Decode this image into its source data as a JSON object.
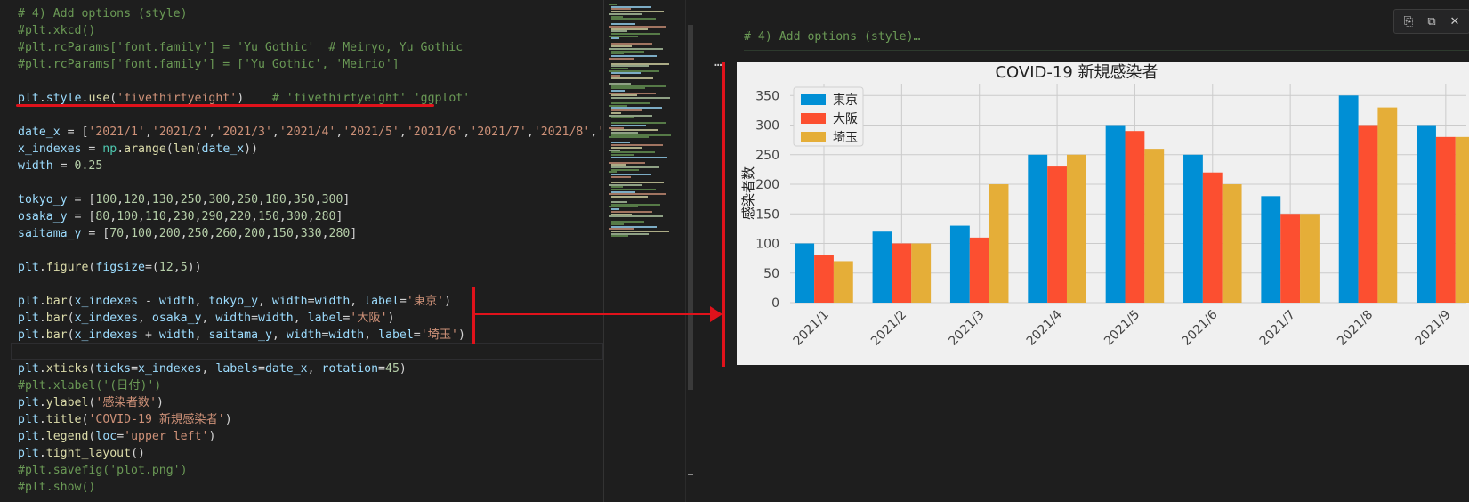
{
  "editor": {
    "lines": [
      {
        "top": 6,
        "spans": [
          [
            "c-cmt",
            "# 4) Add options (style)"
          ]
        ]
      },
      {
        "top": 25,
        "spans": [
          [
            "c-cmt",
            "#plt.xkcd()"
          ]
        ]
      },
      {
        "top": 44,
        "spans": [
          [
            "c-cmt",
            "#plt.rcParams['font.family'] = 'Yu Gothic'  # Meiryo, Yu Gothic"
          ]
        ]
      },
      {
        "top": 63,
        "spans": [
          [
            "c-cmt",
            "#plt.rcParams['font.family'] = ['Yu Gothic', 'Meirio']"
          ]
        ]
      },
      {
        "top": 101,
        "spans": [
          [
            "c-var",
            "plt"
          ],
          [
            "c-op",
            "."
          ],
          [
            "c-var",
            "style"
          ],
          [
            "c-op",
            "."
          ],
          [
            "c-fn",
            "use"
          ],
          [
            "c-op",
            "("
          ],
          [
            "c-str",
            "'fivethirtyeight'"
          ],
          [
            "c-op",
            ")    "
          ],
          [
            "c-cmt",
            "# 'fivethirtyeight' 'ggplot'"
          ]
        ]
      },
      {
        "top": 139,
        "spans": [
          [
            "c-var",
            "date_x"
          ],
          [
            "c-op",
            " = ["
          ],
          [
            "c-str",
            "'2021/1'"
          ],
          [
            "c-op",
            ","
          ],
          [
            "c-str",
            "'2021/2'"
          ],
          [
            "c-op",
            ","
          ],
          [
            "c-str",
            "'2021/3'"
          ],
          [
            "c-op",
            ","
          ],
          [
            "c-str",
            "'2021/4'"
          ],
          [
            "c-op",
            ","
          ],
          [
            "c-str",
            "'2021/5'"
          ],
          [
            "c-op",
            ","
          ],
          [
            "c-str",
            "'2021/6'"
          ],
          [
            "c-op",
            ","
          ],
          [
            "c-str",
            "'2021/7'"
          ],
          [
            "c-op",
            ","
          ],
          [
            "c-str",
            "'2021/8'"
          ],
          [
            "c-op",
            ","
          ],
          [
            "c-str",
            "'202"
          ]
        ]
      },
      {
        "top": 158,
        "spans": [
          [
            "c-var",
            "x_indexes"
          ],
          [
            "c-op",
            " = "
          ],
          [
            "c-cls",
            "np"
          ],
          [
            "c-op",
            "."
          ],
          [
            "c-fn",
            "arange"
          ],
          [
            "c-op",
            "("
          ],
          [
            "c-fn",
            "len"
          ],
          [
            "c-op",
            "("
          ],
          [
            "c-var",
            "date_x"
          ],
          [
            "c-op",
            "))"
          ]
        ]
      },
      {
        "top": 177,
        "spans": [
          [
            "c-var",
            "width"
          ],
          [
            "c-op",
            " = "
          ],
          [
            "c-num",
            "0.25"
          ]
        ]
      },
      {
        "top": 215,
        "spans": [
          [
            "c-var",
            "tokyo_y"
          ],
          [
            "c-op",
            " = ["
          ],
          [
            "c-num",
            "100"
          ],
          [
            "c-op",
            ","
          ],
          [
            "c-num",
            "120"
          ],
          [
            "c-op",
            ","
          ],
          [
            "c-num",
            "130"
          ],
          [
            "c-op",
            ","
          ],
          [
            "c-num",
            "250"
          ],
          [
            "c-op",
            ","
          ],
          [
            "c-num",
            "300"
          ],
          [
            "c-op",
            ","
          ],
          [
            "c-num",
            "250"
          ],
          [
            "c-op",
            ","
          ],
          [
            "c-num",
            "180"
          ],
          [
            "c-op",
            ","
          ],
          [
            "c-num",
            "350"
          ],
          [
            "c-op",
            ","
          ],
          [
            "c-num",
            "300"
          ],
          [
            "c-op",
            "]"
          ]
        ]
      },
      {
        "top": 234,
        "spans": [
          [
            "c-var",
            "osaka_y"
          ],
          [
            "c-op",
            " = ["
          ],
          [
            "c-num",
            "80"
          ],
          [
            "c-op",
            ","
          ],
          [
            "c-num",
            "100"
          ],
          [
            "c-op",
            ","
          ],
          [
            "c-num",
            "110"
          ],
          [
            "c-op",
            ","
          ],
          [
            "c-num",
            "230"
          ],
          [
            "c-op",
            ","
          ],
          [
            "c-num",
            "290"
          ],
          [
            "c-op",
            ","
          ],
          [
            "c-num",
            "220"
          ],
          [
            "c-op",
            ","
          ],
          [
            "c-num",
            "150"
          ],
          [
            "c-op",
            ","
          ],
          [
            "c-num",
            "300"
          ],
          [
            "c-op",
            ","
          ],
          [
            "c-num",
            "280"
          ],
          [
            "c-op",
            "]"
          ]
        ]
      },
      {
        "top": 253,
        "spans": [
          [
            "c-var",
            "saitama_y"
          ],
          [
            "c-op",
            " = ["
          ],
          [
            "c-num",
            "70"
          ],
          [
            "c-op",
            ","
          ],
          [
            "c-num",
            "100"
          ],
          [
            "c-op",
            ","
          ],
          [
            "c-num",
            "200"
          ],
          [
            "c-op",
            ","
          ],
          [
            "c-num",
            "250"
          ],
          [
            "c-op",
            ","
          ],
          [
            "c-num",
            "260"
          ],
          [
            "c-op",
            ","
          ],
          [
            "c-num",
            "200"
          ],
          [
            "c-op",
            ","
          ],
          [
            "c-num",
            "150"
          ],
          [
            "c-op",
            ","
          ],
          [
            "c-num",
            "330"
          ],
          [
            "c-op",
            ","
          ],
          [
            "c-num",
            "280"
          ],
          [
            "c-op",
            "]"
          ]
        ]
      },
      {
        "top": 291,
        "spans": [
          [
            "c-var",
            "plt"
          ],
          [
            "c-op",
            "."
          ],
          [
            "c-fn",
            "figure"
          ],
          [
            "c-op",
            "("
          ],
          [
            "c-var",
            "figsize"
          ],
          [
            "c-op",
            "=("
          ],
          [
            "c-num",
            "12"
          ],
          [
            "c-op",
            ","
          ],
          [
            "c-num",
            "5"
          ],
          [
            "c-op",
            "))"
          ]
        ]
      },
      {
        "top": 329,
        "spans": [
          [
            "c-var",
            "plt"
          ],
          [
            "c-op",
            "."
          ],
          [
            "c-fn",
            "bar"
          ],
          [
            "c-op",
            "("
          ],
          [
            "c-var",
            "x_indexes"
          ],
          [
            "c-op",
            " - "
          ],
          [
            "c-var",
            "width"
          ],
          [
            "c-op",
            ", "
          ],
          [
            "c-var",
            "tokyo_y"
          ],
          [
            "c-op",
            ", "
          ],
          [
            "c-var",
            "width"
          ],
          [
            "c-op",
            "="
          ],
          [
            "c-var",
            "width"
          ],
          [
            "c-op",
            ", "
          ],
          [
            "c-var",
            "label"
          ],
          [
            "c-op",
            "="
          ],
          [
            "c-str",
            "'東京'"
          ],
          [
            "c-op",
            ")"
          ]
        ]
      },
      {
        "top": 348,
        "spans": [
          [
            "c-var",
            "plt"
          ],
          [
            "c-op",
            "."
          ],
          [
            "c-fn",
            "bar"
          ],
          [
            "c-op",
            "("
          ],
          [
            "c-var",
            "x_indexes"
          ],
          [
            "c-op",
            ", "
          ],
          [
            "c-var",
            "osaka_y"
          ],
          [
            "c-op",
            ", "
          ],
          [
            "c-var",
            "width"
          ],
          [
            "c-op",
            "="
          ],
          [
            "c-var",
            "width"
          ],
          [
            "c-op",
            ", "
          ],
          [
            "c-var",
            "label"
          ],
          [
            "c-op",
            "="
          ],
          [
            "c-str",
            "'大阪'"
          ],
          [
            "c-op",
            ")"
          ]
        ]
      },
      {
        "top": 367,
        "spans": [
          [
            "c-var",
            "plt"
          ],
          [
            "c-op",
            "."
          ],
          [
            "c-fn",
            "bar"
          ],
          [
            "c-op",
            "("
          ],
          [
            "c-var",
            "x_indexes"
          ],
          [
            "c-op",
            " + "
          ],
          [
            "c-var",
            "width"
          ],
          [
            "c-op",
            ", "
          ],
          [
            "c-var",
            "saitama_y"
          ],
          [
            "c-op",
            ", "
          ],
          [
            "c-var",
            "width"
          ],
          [
            "c-op",
            "="
          ],
          [
            "c-var",
            "width"
          ],
          [
            "c-op",
            ", "
          ],
          [
            "c-var",
            "label"
          ],
          [
            "c-op",
            "="
          ],
          [
            "c-str",
            "'埼玉'"
          ],
          [
            "c-op",
            ")"
          ]
        ]
      },
      {
        "top": 405,
        "spans": [
          [
            "c-var",
            "plt"
          ],
          [
            "c-op",
            "."
          ],
          [
            "c-fn",
            "xticks"
          ],
          [
            "c-op",
            "("
          ],
          [
            "c-var",
            "ticks"
          ],
          [
            "c-op",
            "="
          ],
          [
            "c-var",
            "x_indexes"
          ],
          [
            "c-op",
            ", "
          ],
          [
            "c-var",
            "labels"
          ],
          [
            "c-op",
            "="
          ],
          [
            "c-var",
            "date_x"
          ],
          [
            "c-op",
            ", "
          ],
          [
            "c-var",
            "rotation"
          ],
          [
            "c-op",
            "="
          ],
          [
            "c-num",
            "45"
          ],
          [
            "c-op",
            ")"
          ]
        ]
      },
      {
        "top": 424,
        "spans": [
          [
            "c-cmt",
            "#plt.xlabel('(日付)')"
          ]
        ]
      },
      {
        "top": 443,
        "spans": [
          [
            "c-var",
            "plt"
          ],
          [
            "c-op",
            "."
          ],
          [
            "c-fn",
            "ylabel"
          ],
          [
            "c-op",
            "("
          ],
          [
            "c-str",
            "'感染者数'"
          ],
          [
            "c-op",
            ")"
          ]
        ]
      },
      {
        "top": 462,
        "spans": [
          [
            "c-var",
            "plt"
          ],
          [
            "c-op",
            "."
          ],
          [
            "c-fn",
            "title"
          ],
          [
            "c-op",
            "("
          ],
          [
            "c-str",
            "'COVID-19 新規感染者'"
          ],
          [
            "c-op",
            ")"
          ]
        ]
      },
      {
        "top": 481,
        "spans": [
          [
            "c-var",
            "plt"
          ],
          [
            "c-op",
            "."
          ],
          [
            "c-fn",
            "legend"
          ],
          [
            "c-op",
            "("
          ],
          [
            "c-var",
            "loc"
          ],
          [
            "c-op",
            "="
          ],
          [
            "c-str",
            "'upper left'"
          ],
          [
            "c-op",
            ")"
          ]
        ]
      },
      {
        "top": 500,
        "spans": [
          [
            "c-var",
            "plt"
          ],
          [
            "c-op",
            "."
          ],
          [
            "c-fn",
            "tight_layout"
          ],
          [
            "c-op",
            "()"
          ]
        ]
      },
      {
        "top": 519,
        "spans": [
          [
            "c-cmt",
            "#plt.savefig('plot.png')"
          ]
        ]
      },
      {
        "top": 538,
        "spans": [
          [
            "c-cmt",
            "#plt.show()"
          ]
        ]
      }
    ]
  },
  "output": {
    "cell_title": "# 4) Add options (style)…",
    "ellipsis": "…",
    "toolbar": {
      "copy_icon": "⎘",
      "paste_icon": "⧉",
      "close_icon": "✕"
    }
  },
  "chart_data": {
    "type": "bar",
    "title": "COVID-19 新規感染者",
    "xlabel": "",
    "ylabel": "感染者数",
    "ylim": [
      0,
      370
    ],
    "yticks": [
      0,
      50,
      100,
      150,
      200,
      250,
      300,
      350
    ],
    "categories": [
      "2021/1",
      "2021/2",
      "2021/3",
      "2021/4",
      "2021/5",
      "2021/6",
      "2021/7",
      "2021/8",
      "2021/9"
    ],
    "series": [
      {
        "name": "東京",
        "color": "#008fd5",
        "values": [
          100,
          120,
          130,
          250,
          300,
          250,
          180,
          350,
          300
        ]
      },
      {
        "name": "大阪",
        "color": "#fc4f30",
        "values": [
          80,
          100,
          110,
          230,
          290,
          220,
          150,
          300,
          280
        ]
      },
      {
        "name": "埼玉",
        "color": "#e5ae38",
        "values": [
          70,
          100,
          200,
          250,
          260,
          200,
          150,
          330,
          280
        ]
      }
    ],
    "grid": true,
    "legend": "upper-left",
    "style": "fivethirtyeight"
  }
}
